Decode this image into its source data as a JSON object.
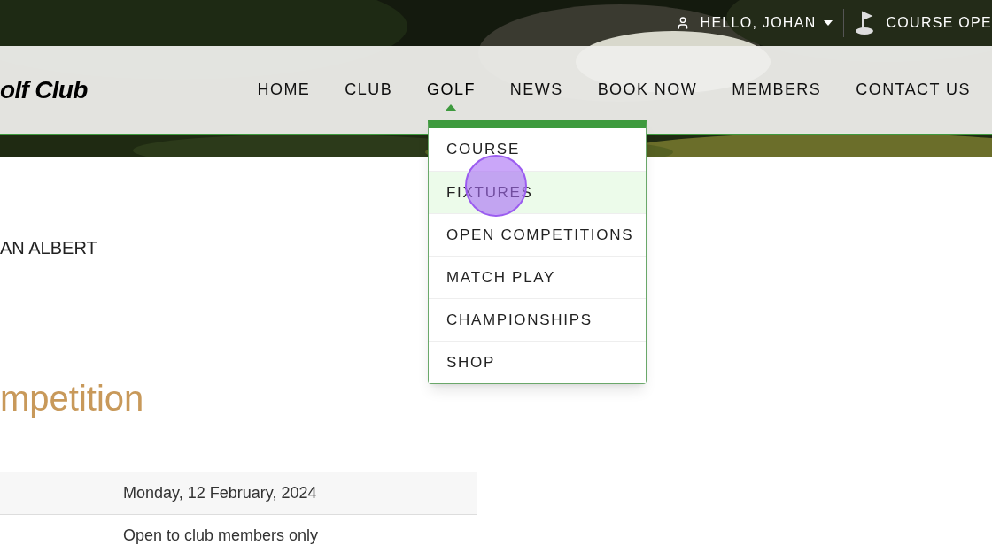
{
  "top_bar": {
    "user": "HELLO, JOHAN",
    "status": "COURSE OPE"
  },
  "logo": "olf Club",
  "nav": [
    {
      "label": "HOME",
      "selected": false
    },
    {
      "label": "CLUB",
      "selected": false
    },
    {
      "label": "GOLF",
      "selected": true
    },
    {
      "label": "NEWS",
      "selected": false
    },
    {
      "label": "BOOK NOW",
      "selected": false
    },
    {
      "label": "MEMBERS",
      "selected": false
    },
    {
      "label": "CONTACT US",
      "selected": false
    }
  ],
  "dropdown": [
    {
      "label": "COURSE",
      "selected": false
    },
    {
      "label": "FIXTURES",
      "selected": true
    },
    {
      "label": "OPEN COMPETITIONS",
      "selected": false
    },
    {
      "label": "MATCH PLAY",
      "selected": false
    },
    {
      "label": "CHAMPIONSHIPS",
      "selected": false
    },
    {
      "label": "SHOP",
      "selected": false
    }
  ],
  "member_name": "AN ALBERT",
  "heading": "mpetition",
  "details": [
    {
      "value": "Monday, 12 February, 2024"
    },
    {
      "value": "Open to club members only"
    }
  ]
}
